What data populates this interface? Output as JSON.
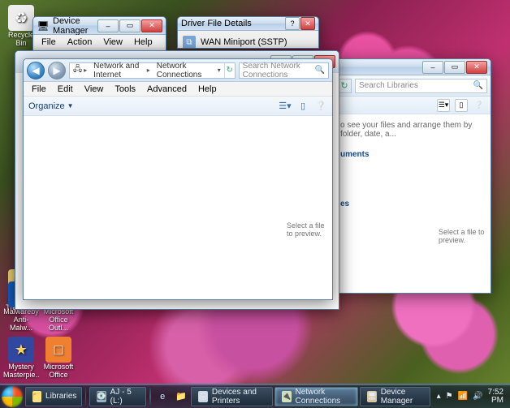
{
  "desktop": {
    "icons": [
      {
        "name": "recycle-bin",
        "label": "Recycle Bin",
        "glyph": "♻",
        "bg": "#ffffff00"
      },
      {
        "name": "little-sf",
        "label": "Little SF Treasur...",
        "glyph": "📁",
        "bg": "#f7d774"
      },
      {
        "name": "malwarebytes",
        "label": "Malwareby Anti-Malw...",
        "glyph": "M",
        "bg": "#1560c8"
      },
      {
        "name": "ms-office-outlook",
        "label": "Microsoft Office Outl...",
        "glyph": "O",
        "bg": "#f7b733"
      },
      {
        "name": "mystery-masterpiece",
        "label": "Mystery Masterpie...",
        "glyph": "★",
        "bg": "#3048a0"
      },
      {
        "name": "ms-office",
        "label": "Microsoft Office",
        "glyph": "□",
        "bg": "#f08030"
      }
    ]
  },
  "devmgr": {
    "title": "Device Manager",
    "menu": [
      "File",
      "Action",
      "View",
      "Help"
    ]
  },
  "driver": {
    "title": "Driver File Details",
    "item": "WAN Miniport (SSTP)"
  },
  "libraries": {
    "search_placeholder": "Search Libraries",
    "body_hint": "o see your files and arrange them by folder, date, a...",
    "subhead": "uments",
    "cat2": "es",
    "preview": "Select a file to preview."
  },
  "net": {
    "breadcrumb": [
      "Network and Internet",
      "Network Connections"
    ],
    "search_placeholder": "Search Network Connections",
    "menu": [
      "File",
      "Edit",
      "View",
      "Tools",
      "Advanced",
      "Help"
    ],
    "organize": "Organize",
    "preview": "Select a file to preview."
  },
  "taskbar": {
    "buttons": [
      {
        "icon": "📁",
        "label": "Libraries"
      },
      {
        "icon": "💽",
        "label": "AJ - 5 (L:)"
      },
      {
        "icon": "🖨",
        "label": "Devices and Printers"
      },
      {
        "icon": "🔌",
        "label": "Network Connections",
        "active": true
      },
      {
        "icon": "🖥",
        "label": "Device Manager"
      }
    ],
    "clock": "7:52 PM"
  }
}
